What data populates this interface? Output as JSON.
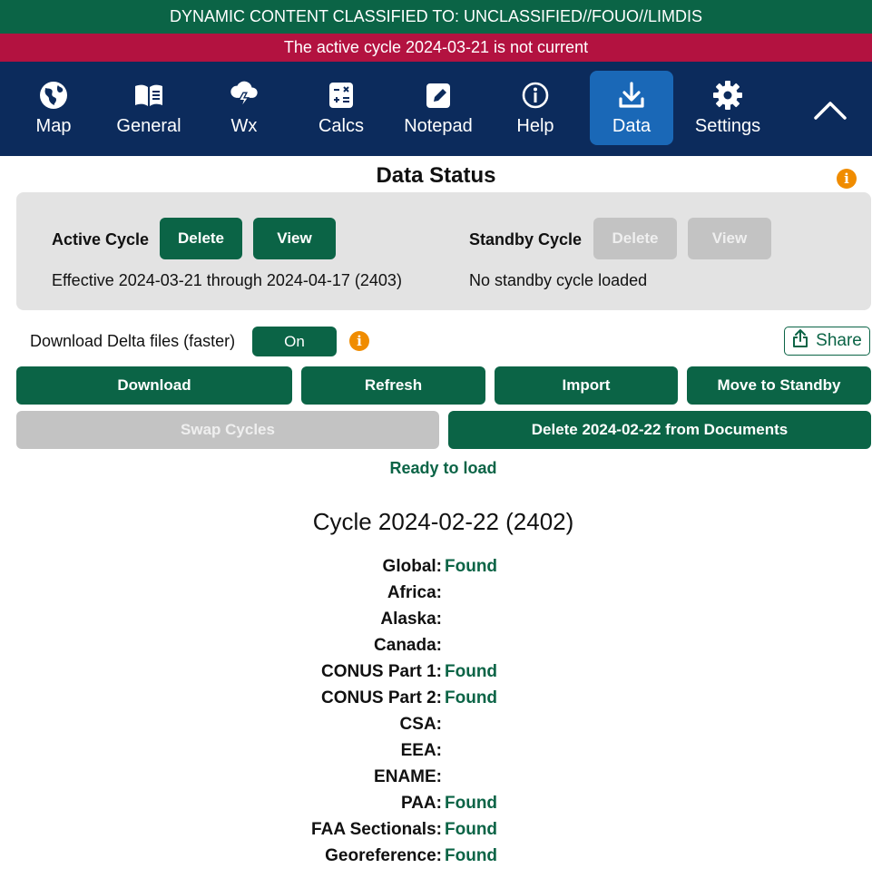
{
  "banners": {
    "classification": "DYNAMIC CONTENT CLASSIFIED TO: UNCLASSIFIED//FOUO//LIMDIS",
    "alert": "The active cycle 2024-03-21 is not current"
  },
  "colors": {
    "classification_bg": "#0b6446",
    "alert_bg": "#b31240",
    "nav_bg": "#0c2b5c",
    "nav_active": "#1a68b7",
    "accent_green": "#0b6446",
    "info_orange": "#f08c00"
  },
  "nav": {
    "items": [
      {
        "label": "Map",
        "icon": "globe-icon"
      },
      {
        "label": "General",
        "icon": "book-icon"
      },
      {
        "label": "Wx",
        "icon": "storm-cloud-icon"
      },
      {
        "label": "Calcs",
        "icon": "calculator-icon"
      },
      {
        "label": "Notepad",
        "icon": "notepad-icon"
      },
      {
        "label": "Help",
        "icon": "info-icon"
      },
      {
        "label": "Data",
        "icon": "download-icon",
        "active": true
      },
      {
        "label": "Settings",
        "icon": "gear-icon"
      }
    ],
    "collapse_icon": "chevron-up-icon"
  },
  "status": {
    "title": "Data Status",
    "active_cycle": {
      "label": "Active Cycle",
      "delete_label": "Delete",
      "view_label": "View",
      "effective": "Effective 2024-03-21 through 2024-04-17 (2403)"
    },
    "standby_cycle": {
      "label": "Standby Cycle",
      "delete_label": "Delete",
      "view_label": "View",
      "text": "No standby cycle loaded"
    }
  },
  "options": {
    "delta_label": "Download Delta files (faster)",
    "delta_toggle": "On",
    "share_label": "Share"
  },
  "actions": {
    "download": "Download",
    "refresh": "Refresh",
    "import": "Import",
    "move_to_standby": "Move to Standby",
    "swap_cycles": "Swap Cycles",
    "delete_docs": "Delete 2024-02-22 from Documents"
  },
  "load_status": "Ready to load",
  "cycle": {
    "heading": "Cycle 2024-02-22 (2402)",
    "regions": [
      {
        "name": "Global:",
        "status": "Found"
      },
      {
        "name": "Africa:",
        "status": ""
      },
      {
        "name": "Alaska:",
        "status": ""
      },
      {
        "name": "Canada:",
        "status": ""
      },
      {
        "name": "CONUS Part 1:",
        "status": "Found"
      },
      {
        "name": "CONUS Part 2:",
        "status": "Found"
      },
      {
        "name": "CSA:",
        "status": ""
      },
      {
        "name": "EEA:",
        "status": ""
      },
      {
        "name": "ENAME:",
        "status": ""
      },
      {
        "name": "PAA:",
        "status": "Found"
      },
      {
        "name": "FAA Sectionals:",
        "status": "Found"
      },
      {
        "name": "Georeference:",
        "status": "Found"
      }
    ]
  }
}
